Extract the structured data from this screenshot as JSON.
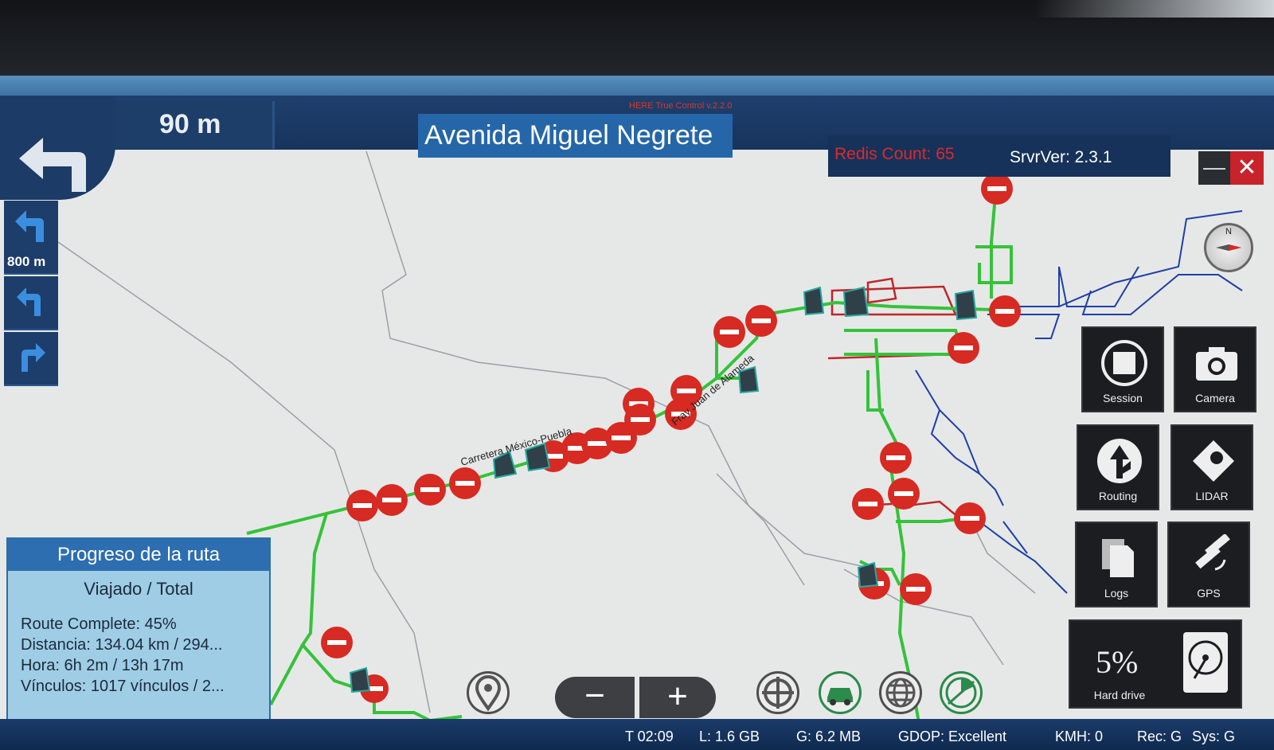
{
  "app": {
    "version": "HERE True Control v.2.2.0"
  },
  "navigation": {
    "next_turn_distance": "90 m",
    "current_street": "Avenida Miguel Negrete",
    "upcoming_turn_distance": "800 m"
  },
  "server": {
    "redis_count": "Redis Count: 65",
    "server_version": "SrvrVer: 2.3.1"
  },
  "window_controls": {
    "minimize": "—",
    "close": "✕"
  },
  "map": {
    "road_labels": [
      "Carretera México-Puebla",
      "Fray Juan de Alameda"
    ],
    "compass_north": "N",
    "colors": {
      "route": "#35c23a",
      "pin": "#d62a22",
      "road": "#1f3fa8",
      "restricted": "#c0262a"
    }
  },
  "tools": {
    "session": "Session",
    "camera": "Camera",
    "routing": "Routing",
    "lidar": "LIDAR",
    "logs": "Logs",
    "gps": "GPS",
    "hard_drive_percent": "5%",
    "hard_drive": "Hard drive"
  },
  "route_progress": {
    "title": "Progreso de la ruta",
    "subtitle": "Viajado / Total",
    "route_complete": "Route Complete: 45%",
    "distance": "Distancia: 134.04 km / 294...",
    "time": "Hora: 6h 2m / 13h 17m",
    "links": "Vínculos: 1017 vínculos / 2..."
  },
  "toolbar": {
    "zoom_out": "−",
    "zoom_in": "+"
  },
  "status_bar": {
    "time": "T 02:09",
    "local_storage": "L:    1.6 GB",
    "gps_storage": "G:    6.2 MB",
    "gdop": "GDOP: Excellent",
    "speed": "KMH: 0",
    "rec": "Rec: G",
    "sys": "Sys: G"
  }
}
